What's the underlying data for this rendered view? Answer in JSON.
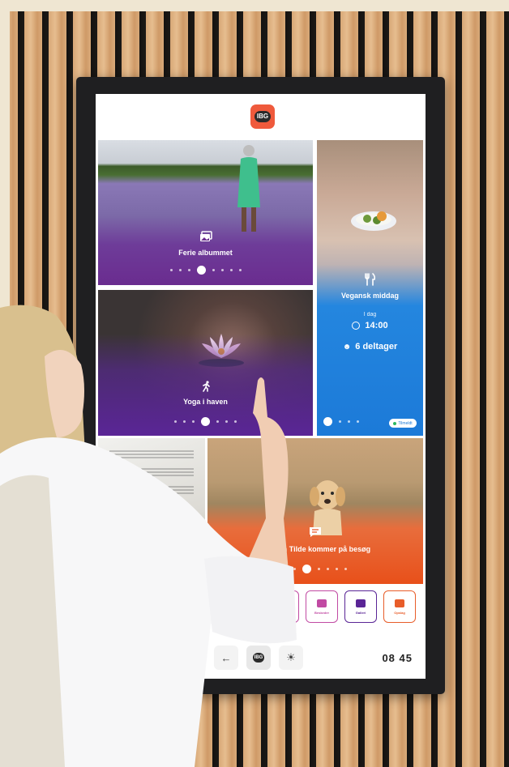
{
  "app": {
    "logo_text": "IBG"
  },
  "tiles": {
    "album": {
      "title": "Ferie albummet",
      "icon": "photo-album-icon",
      "dots": 8,
      "active_dot": 3
    },
    "yoga": {
      "title": "Yoga i haven",
      "icon": "running-figure-icon",
      "dots": 7,
      "active_dot": 3
    },
    "dinner": {
      "title": "Vegansk middag",
      "icon": "fork-knife-icon",
      "day_label": "I dag",
      "time": "14:00",
      "participants": "6 deltager",
      "dots": 4,
      "active_dot": 0,
      "badge": "Tilmeldt"
    },
    "visit": {
      "title": "Hunden Tilde kommer på besøg",
      "icon": "message-icon",
      "dots": 7,
      "active_dot": 2
    }
  },
  "tray": [
    {
      "label": "Nyhed",
      "color": "#c14aa3",
      "icon": "news-icon"
    },
    {
      "label": "Beskeder",
      "color": "#c14aa3",
      "icon": "chat-icon"
    },
    {
      "label": "Galleri",
      "color": "#5a2596",
      "icon": "gallery-icon"
    },
    {
      "label": "Opslag",
      "color": "#e85d2a",
      "icon": "notice-icon"
    }
  ],
  "nav": {
    "back_icon": "arrow-left-icon",
    "home_label": "IBG",
    "brightness_icon": "sun-icon"
  },
  "clock": {
    "hours": "08",
    "minutes": "45"
  },
  "colors": {
    "brand": "#ef5a3c",
    "purple": "#5a2596",
    "blue": "#1c7ad8",
    "orange": "#e8501a"
  }
}
